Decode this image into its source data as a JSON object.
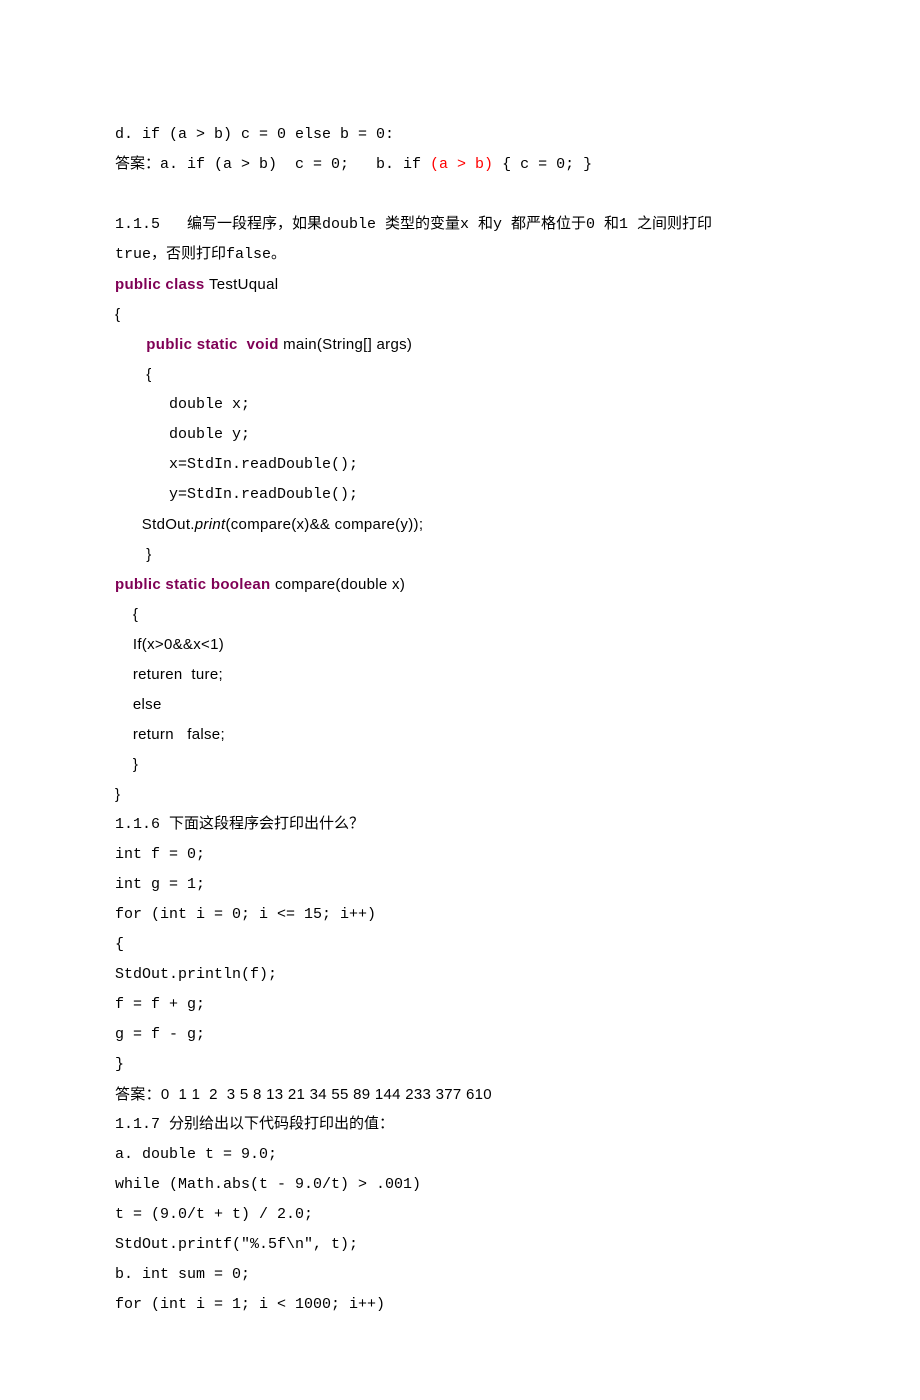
{
  "lines": [
    {
      "cls": "mono",
      "segs": [
        {
          "t": "d. if (a > b) c = 0 else b = 0:"
        }
      ]
    },
    {
      "cls": "mono",
      "segs": [
        {
          "t": "答案：a. if (a > b)  c = 0;   b. if "
        },
        {
          "t": "(a > b)",
          "c": "err"
        },
        {
          "t": " { c = 0; }"
        }
      ]
    },
    {
      "cls": "mono",
      "segs": [
        {
          "t": " "
        }
      ]
    },
    {
      "cls": "mono",
      "segs": [
        {
          "t": "1.1.5   编写一段程序，如果double 类型的变量x 和y 都严格位于0 和1 之间则打印"
        }
      ]
    },
    {
      "cls": "mono",
      "segs": [
        {
          "t": "true，否则打印false。"
        }
      ]
    },
    {
      "cls": "arial",
      "segs": [
        {
          "t": "public class ",
          "c": "kw"
        },
        {
          "t": "TestUqual"
        }
      ]
    },
    {
      "cls": "arial",
      "segs": [
        {
          "t": "{"
        }
      ]
    },
    {
      "cls": "arial",
      "segs": [
        {
          "t": "       "
        },
        {
          "t": "public static  void ",
          "c": "kw"
        },
        {
          "t": "main(String[] args)"
        }
      ]
    },
    {
      "cls": "arial",
      "segs": [
        {
          "t": "       {"
        }
      ]
    },
    {
      "cls": "mono",
      "segs": [
        {
          "t": "      double x;"
        }
      ]
    },
    {
      "cls": "mono",
      "segs": [
        {
          "t": "      double y;"
        }
      ]
    },
    {
      "cls": "mono",
      "segs": [
        {
          "t": "      x=StdIn.readDouble();"
        }
      ]
    },
    {
      "cls": "mono",
      "segs": [
        {
          "t": "      y=StdIn.readDouble();"
        }
      ]
    },
    {
      "cls": "arial",
      "segs": [
        {
          "t": "      StdOut."
        },
        {
          "t": "print",
          "c": "italic"
        },
        {
          "t": "(compare(x)&& compare(y));"
        }
      ]
    },
    {
      "cls": "arial",
      "segs": [
        {
          "t": "       }"
        }
      ]
    },
    {
      "cls": "arial",
      "segs": [
        {
          "t": "public static boolean ",
          "c": "kw"
        },
        {
          "t": "compare(double x)"
        }
      ]
    },
    {
      "cls": "arial",
      "segs": [
        {
          "t": "    {"
        }
      ]
    },
    {
      "cls": "arial",
      "segs": [
        {
          "t": "    If(x>0&&x<1)"
        }
      ]
    },
    {
      "cls": "arial",
      "segs": [
        {
          "t": "    returen  ture;"
        }
      ]
    },
    {
      "cls": "arial",
      "segs": [
        {
          "t": "    else"
        }
      ]
    },
    {
      "cls": "arial",
      "segs": [
        {
          "t": "    return   false;"
        }
      ]
    },
    {
      "cls": "arial",
      "segs": [
        {
          "t": "    }"
        }
      ]
    },
    {
      "cls": "arial",
      "segs": [
        {
          "t": "}"
        }
      ]
    },
    {
      "cls": "mono",
      "segs": [
        {
          "t": "1.1.6 下面这段程序会打印出什么？"
        }
      ]
    },
    {
      "cls": "mono",
      "segs": [
        {
          "t": "int f = 0;"
        }
      ]
    },
    {
      "cls": "mono",
      "segs": [
        {
          "t": "int g = 1;"
        }
      ]
    },
    {
      "cls": "mono",
      "segs": [
        {
          "t": "for (int i = 0; i <= 15; i++)"
        }
      ]
    },
    {
      "cls": "mono",
      "segs": [
        {
          "t": "{"
        }
      ]
    },
    {
      "cls": "mono",
      "segs": [
        {
          "t": "StdOut.println(f);"
        }
      ]
    },
    {
      "cls": "mono",
      "segs": [
        {
          "t": "f = f + g;"
        }
      ]
    },
    {
      "cls": "mono",
      "segs": [
        {
          "t": "g = f - g;"
        }
      ]
    },
    {
      "cls": "mono",
      "segs": [
        {
          "t": "}"
        }
      ]
    },
    {
      "cls": "arial",
      "segs": [
        {
          "t": "答案：0  1 1  2  3 5 8 13 21 34 55 89 144 233 377 610"
        }
      ]
    },
    {
      "cls": "mono",
      "segs": [
        {
          "t": "1.1.7 分别给出以下代码段打印出的值："
        }
      ]
    },
    {
      "cls": "mono",
      "segs": [
        {
          "t": "a. double t = 9.0;"
        }
      ]
    },
    {
      "cls": "mono",
      "segs": [
        {
          "t": "while (Math.abs(t - 9.0/t) > .001)"
        }
      ]
    },
    {
      "cls": "mono",
      "segs": [
        {
          "t": "t = (9.0/t + t) / 2.0;"
        }
      ]
    },
    {
      "cls": "mono",
      "segs": [
        {
          "t": "StdOut.printf(\"%.5f\\n\", t);"
        }
      ]
    },
    {
      "cls": "mono",
      "segs": [
        {
          "t": "b. int sum = 0;"
        }
      ]
    },
    {
      "cls": "mono",
      "segs": [
        {
          "t": "for (int i = 1; i < 1000; i++)"
        }
      ]
    }
  ]
}
